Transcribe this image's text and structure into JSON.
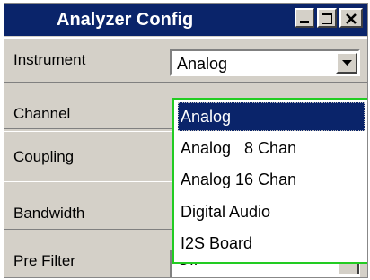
{
  "window": {
    "title": "Analyzer Config",
    "title_bar_color": "#0a246a",
    "buttons": [
      "minimize-icon",
      "maximize-icon",
      "close-icon"
    ]
  },
  "rows": [
    {
      "label": "Instrument",
      "value": "Analog"
    },
    {
      "label": "Channel"
    },
    {
      "label": "Coupling"
    },
    {
      "label": "Bandwidth"
    },
    {
      "label": "Pre Filter",
      "value": "Off"
    }
  ],
  "dropdown": {
    "selected": "Analog",
    "options": [
      "Analog",
      "Analog   8 Chan",
      "Analog 16 Chan",
      "Digital Audio",
      "I2S Board"
    ],
    "border_color": "#22cc22",
    "selected_color": "#0a246a"
  }
}
